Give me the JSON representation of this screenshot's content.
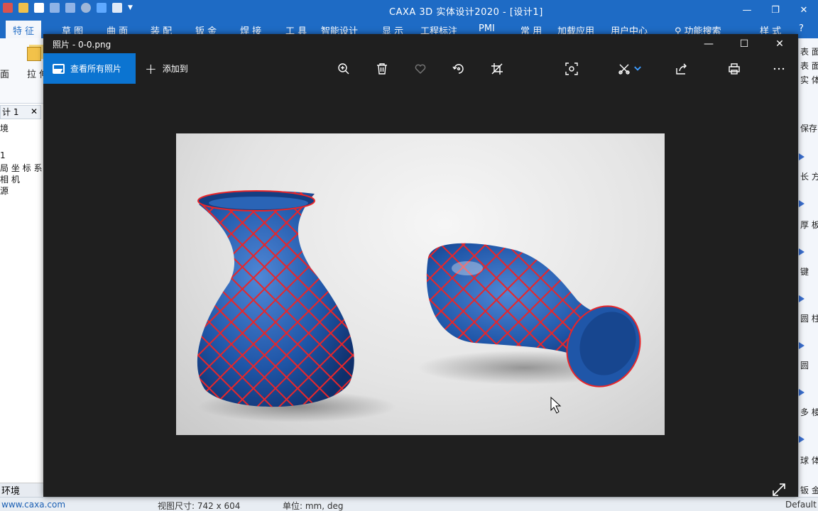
{
  "caxa": {
    "title": "CAXA 3D 实体设计2020 - [设计1]",
    "ribbon_tabs": [
      "特 征",
      "草 图",
      "曲 面",
      "装 配",
      "钣 金",
      "焊 接",
      "工 具",
      "智能设计",
      "显 示",
      "工程标注",
      "PMI",
      "常 用",
      "加载应用",
      "用户中心",
      "功能搜索",
      "样 式"
    ],
    "ribbon_left": {
      "label_mian": "面",
      "label_lashen": "拉 伸"
    },
    "tree": {
      "tab_label": "计 1",
      "header": "境",
      "items": [
        "1",
        "局 坐 标 系",
        "相 机",
        "源"
      ]
    },
    "env_label": "环境",
    "right_panel": [
      "表 面",
      "表 面",
      "实 体",
      "保存",
      "长 方",
      "厚 板",
      "键",
      "圆 柱",
      "圆",
      "多 棱",
      "球 体",
      "钣 金"
    ],
    "status": {
      "website": "www.caxa.com",
      "view_size": "视图尺寸: 742 x 604",
      "unit": "单位: mm, deg",
      "default": "Default"
    }
  },
  "photos": {
    "window_title": "照片 - 0-0.png",
    "view_all_label": "查看所有照片",
    "add_to_label": "添加到",
    "icons": [
      "zoom-in-icon",
      "trash-icon",
      "heart-icon",
      "rotate-icon",
      "crop-icon",
      "enhance-icon",
      "edit-create-icon",
      "share-icon",
      "print-icon",
      "more-icon"
    ],
    "colors": {
      "accent": "#0b74d1",
      "vase_body": "#1f56a8",
      "vase_lattice": "#e8262a"
    }
  }
}
